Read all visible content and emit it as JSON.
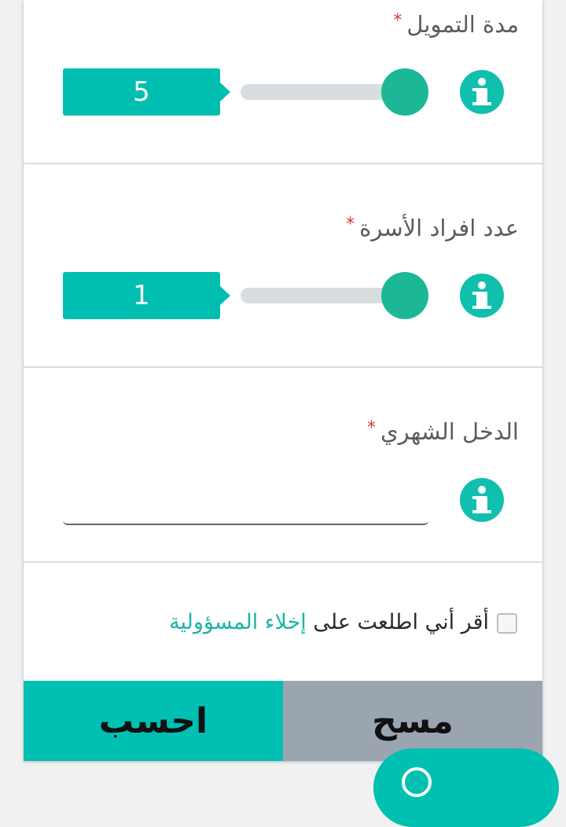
{
  "financing_period": {
    "label": "مدة التمويل",
    "required_mark": "*",
    "value": "5"
  },
  "family_members": {
    "label": "عدد افراد الأسرة",
    "required_mark": "*",
    "value": "1"
  },
  "monthly_income": {
    "label": "الدخل الشهري",
    "required_mark": "*",
    "value": ""
  },
  "agreement": {
    "text": "أقر أني اطلعت على ",
    "link_text": "إخلاء المسؤولية"
  },
  "buttons": {
    "calculate": "احسب",
    "clear": "مسح"
  },
  "colors": {
    "accent": "#00c0b1",
    "slider_thumb": "#1cb895",
    "clear_button": "#9aa5b0",
    "required": "#e0323c"
  }
}
